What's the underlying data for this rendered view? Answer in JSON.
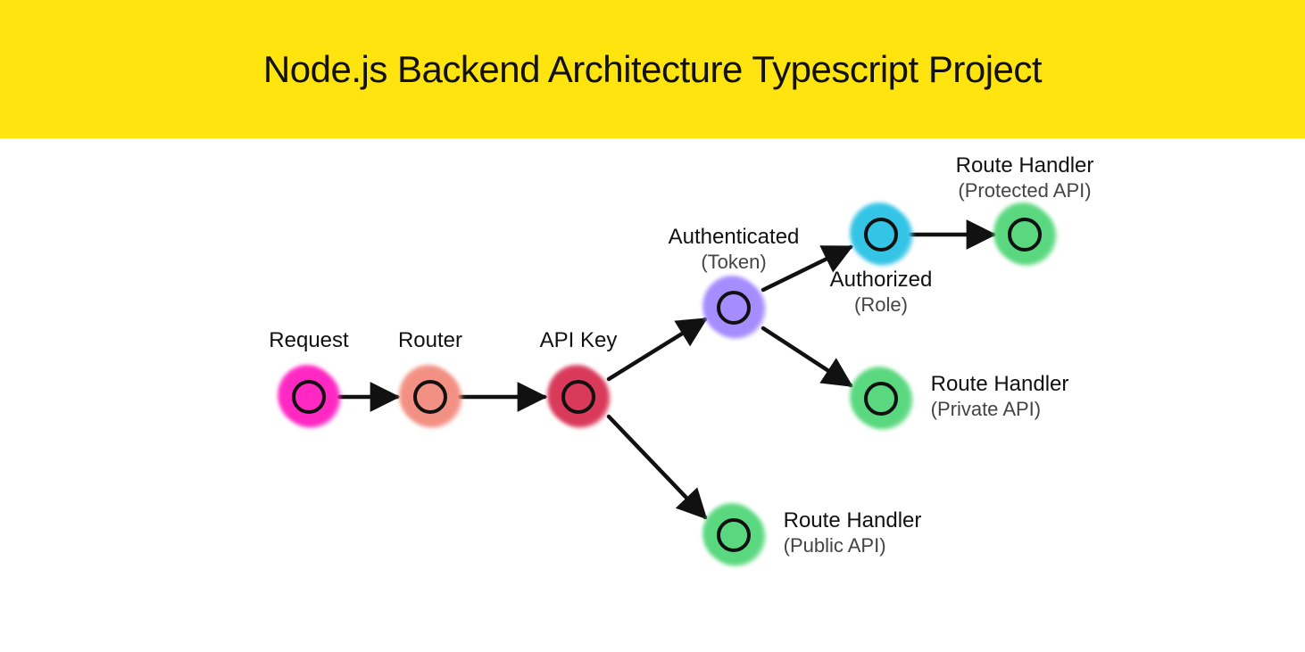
{
  "header": {
    "title": "Node.js Backend Architecture Typescript Project"
  },
  "nodes": {
    "request": {
      "label": "Request"
    },
    "router": {
      "label": "Router"
    },
    "apikey": {
      "label": "API Key"
    },
    "auth": {
      "label": "Authenticated",
      "sub": "(Token)"
    },
    "authorized": {
      "label": "Authorized",
      "sub": "(Role)"
    },
    "protected": {
      "label": "Route Handler",
      "sub": "(Protected API)"
    },
    "private": {
      "label": "Route Handler",
      "sub": "(Private API)"
    },
    "public": {
      "label": "Route Handler",
      "sub": "(Public API)"
    }
  },
  "colors": {
    "pink": "#ff28c3",
    "coral": "#f39184",
    "red": "#d93a5b",
    "violet": "#a58cff",
    "cyan": "#34c4e6",
    "green": "#5bd87f"
  }
}
